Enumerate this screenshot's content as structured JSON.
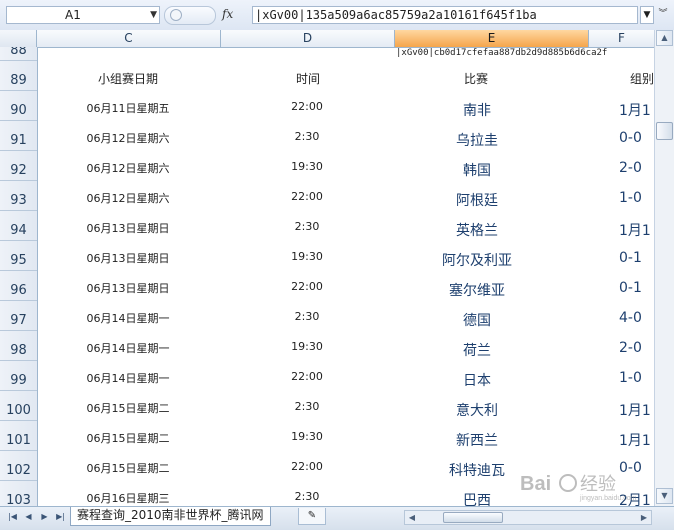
{
  "formula_bar": {
    "name_box": "A1",
    "fx_label": "fx",
    "formula": "|xGv00|135a509a6ac85759a2a10161f645f1ba"
  },
  "columns": [
    {
      "label": "C",
      "selected": false
    },
    {
      "label": "D",
      "selected": false
    },
    {
      "label": "E",
      "selected": true
    },
    {
      "label": "F",
      "selected": false
    }
  ],
  "row_numbers": [
    "88",
    "89",
    "90",
    "91",
    "92",
    "93",
    "94",
    "95",
    "96",
    "97",
    "98",
    "99",
    "100",
    "101",
    "102",
    "103"
  ],
  "note_cell": "|xGv00|cb0d17cfefaa887db2d9d885b6d6ca2f",
  "table": {
    "headers": {
      "date": "小组赛日期",
      "time": "时间",
      "match": "比赛",
      "group": "组别"
    },
    "rows": [
      {
        "date": "06月11日星期五",
        "time": "22:00",
        "match": "南非",
        "score": "1月1"
      },
      {
        "date": "06月12日星期六",
        "time": "2:30",
        "match": "乌拉圭",
        "score": "0-0"
      },
      {
        "date": "06月12日星期六",
        "time": "19:30",
        "match": "韩国",
        "score": "2-0"
      },
      {
        "date": "06月12日星期六",
        "time": "22:00",
        "match": "阿根廷",
        "score": "1-0"
      },
      {
        "date": "06月13日星期日",
        "time": "2:30",
        "match": "英格兰",
        "score": "1月1"
      },
      {
        "date": "06月13日星期日",
        "time": "19:30",
        "match": "阿尔及利亚",
        "score": "0-1"
      },
      {
        "date": "06月13日星期日",
        "time": "22:00",
        "match": "塞尔维亚",
        "score": "0-1"
      },
      {
        "date": "06月14日星期一",
        "time": "2:30",
        "match": "德国",
        "score": "4-0"
      },
      {
        "date": "06月14日星期一",
        "time": "19:30",
        "match": "荷兰",
        "score": "2-0"
      },
      {
        "date": "06月14日星期一",
        "time": "22:00",
        "match": "日本",
        "score": "1-0"
      },
      {
        "date": "06月15日星期二",
        "time": "2:30",
        "match": "意大利",
        "score": "1月1"
      },
      {
        "date": "06月15日星期二",
        "time": "19:30",
        "match": "新西兰",
        "score": "1月1"
      },
      {
        "date": "06月15日星期二",
        "time": "22:00",
        "match": "科特迪瓦",
        "score": "0-0"
      },
      {
        "date": "06月16日星期三",
        "time": "2:30",
        "match": "巴西",
        "score": "2月1"
      }
    ]
  },
  "sheet_tab": "赛程查询_2010南非世界杯_腾讯网",
  "watermark": {
    "brand": "Bai",
    "text": "经验",
    "url": "jingyan.baidu.com"
  }
}
